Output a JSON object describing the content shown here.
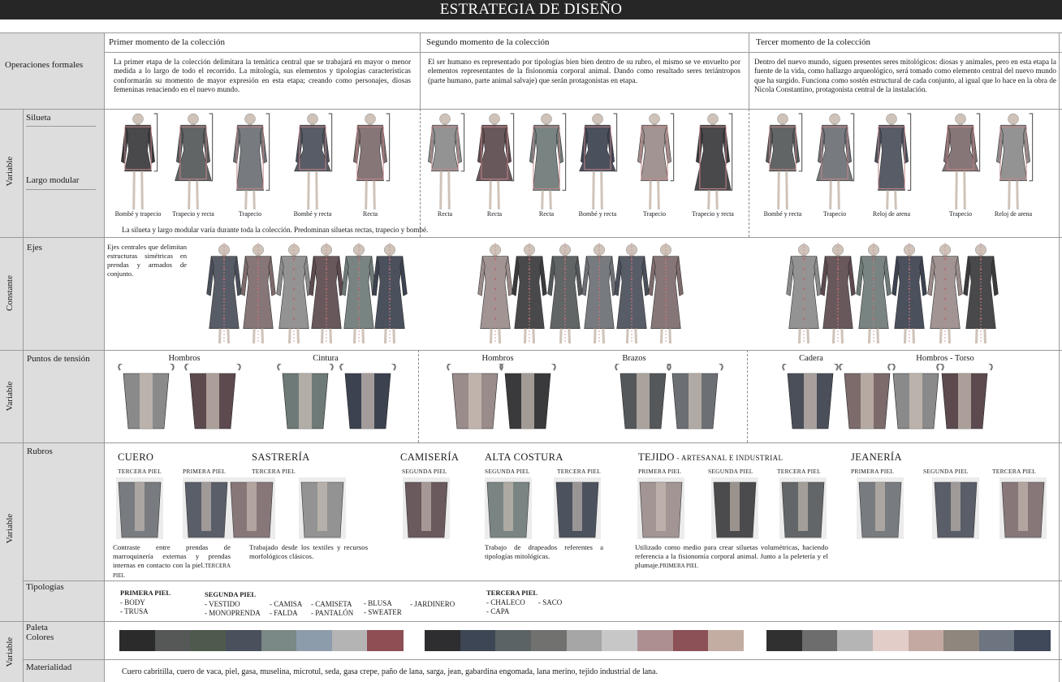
{
  "title": "ESTRATEGIA DE DISEÑO",
  "columns": [
    "Primer momento de la colección",
    "Segundo momento de la colección",
    "Tercer momento de la colección"
  ],
  "row_groups": {
    "variable": "Variable",
    "constante": "Constante"
  },
  "rows": {
    "operaciones": "Operaciones formales",
    "silueta": "Silueta",
    "largo": "Largo modular",
    "ejes": "Ejes",
    "puntos": "Puntos de tensión",
    "rubros": "Rubros",
    "tipologias": "Tipologías",
    "paleta": "Paleta\nColores",
    "materialidad": "Materialidad"
  },
  "operaciones_text": [
    "La primer etapa de la colección delimitara la temática central que se trabajará en mayor o menor medida a lo largo de todo el recorrido. La mitología, sus elementos y tipologías características conformarán su momento de mayor expresión en esta etapa; creando como personajes, diosas femeninas renaciendo en el nuevo mundo.",
    "El ser humano es representado por tipologías bien bien dentro de su rubro, el mismo se ve envuelto por elementos representantes de la fisionomía corporal animal. Dando como resultado seres teriántropos (parte humano, parte animal salvaje) que serán protagonistas en etapa.",
    "Dentro del nuevo mundo, siguen presentes seres mitológicos: diosas y animales, pero en esta etapa la fuente de la vida, como hallazgo arqueológico, será tomado como elemento central del nuevo mundo que ha surgido. Funciona como sostén estructural de cada conjunto, al igual que lo hace en la obra de Nicola Constantino, protagonista central de la instalación."
  ],
  "silueta_captions": {
    "col1": [
      "Bombé y trapecio",
      "Trapecio y recta",
      "Trapecio",
      "Bombé y recta",
      "Recta"
    ],
    "col2": [
      "Recta",
      "Recta",
      "Recta",
      "Bombé y recta",
      "Trapecio",
      "Trapecio y recta"
    ],
    "col3": [
      "Bombé y recta",
      "Trapecio",
      "Reloj de arena",
      "Trapecio",
      "Reloj de arena"
    ]
  },
  "silueta_note": "La silueta y largo modular varía durante toda la colección. Predominan siluetas rectas, trapecio y bombé.",
  "ejes_text": "Ejes centrales que delimitan estructuras simétricas en prendas y armados de conjunto.",
  "puntos_labels": [
    "Hombros",
    "Cintura",
    "Hombros",
    "Brazos",
    "Cadera",
    "Hombros - Torso"
  ],
  "rubros": {
    "cuero": {
      "name": "CUERO",
      "tags": [
        "TERCERA PIEL",
        "PRIMERA PIEL"
      ],
      "text": "Contraste entre prendas de marroquinería externas y prendas internas en contacto con la piel.",
      "tail": "TERCERA PIEL"
    },
    "sastreria": {
      "name": "SASTRERÍA",
      "tags": [
        "TERCERA PIEL"
      ],
      "text": "Trabajado desde los textiles y recursos morfológicos clásicos."
    },
    "camiseria": {
      "name": "CAMISERÍA",
      "tags": [
        "SEGUNDA PIEL"
      ]
    },
    "alta_costura": {
      "name": "ALTA COSTURA",
      "tags": [
        "SEGUNDA PIEL",
        "TERCERA PIEL"
      ],
      "text": "Trabajo de drapeados referentes a tipologías mitológicas."
    },
    "tejido": {
      "name": "TEJIDO",
      "suffix": " - ARTESANAL E INDUSTRIAL",
      "tags": [
        "PRIMERA PIEL",
        "SEGUNDA PIEL",
        "TERCERA PIEL"
      ],
      "text": "Utilizado como medio para crear siluetas volumétricas, haciendo referencia a la fisionomía corporal animal. Junto a la peletería y el plumaje.",
      "tail": "PRIMERA PIEL"
    },
    "jeaneria": {
      "name": "JEANERÍA",
      "tags": [
        "PRIMERA PIEL",
        "SEGUNDA PIEL",
        "TERCERA PIEL"
      ]
    }
  },
  "tipologias": {
    "primera": {
      "title": "PRIMERA PIEL",
      "items": [
        "- BODY",
        "- TRUSA"
      ]
    },
    "segunda": {
      "title": "SEGUNDA PIEL",
      "cols": [
        [
          "- VESTIDO",
          "- MONOPRENDA"
        ],
        [
          "- CAMISA",
          "- FALDA"
        ],
        [
          "- CAMISETA",
          "- PANTALÓN"
        ],
        [
          "- BLUSA",
          "- SWEATER"
        ],
        [
          "- JARDINERO"
        ]
      ]
    },
    "tercera": {
      "title": "TERCERA PIEL",
      "cols": [
        [
          "- CHALECO",
          "- CAPA"
        ],
        [
          "- SACO"
        ]
      ]
    }
  },
  "palette": {
    "col1": [
      "#2b2b2c",
      "#555856",
      "#4e5a4c",
      "#4a505c",
      "#7a8886",
      "#8d9cab",
      "#b4b4b4",
      "#8e4f54"
    ],
    "col2": [
      "#2e2d2f",
      "#3d4654",
      "#5c6364",
      "#717170",
      "#a6a6a6",
      "#c7c7c7",
      "#ad8f91",
      "#8c5157",
      "#c3ada2"
    ],
    "col3": [
      "#303031",
      "#6d6d6d",
      "#b5b5b5",
      "#e2cdc9",
      "#c4a9a3",
      "#8f867e",
      "#6c7580",
      "#40495a"
    ]
  },
  "materialidad_text": "Cuero cabritilla, cuero de vaca, piel, gasa, muselina, microtul, seda, gasa crepe, paño de lana, sarga, jean, gabardina engomada, lana merino, tejido industrial de lana."
}
